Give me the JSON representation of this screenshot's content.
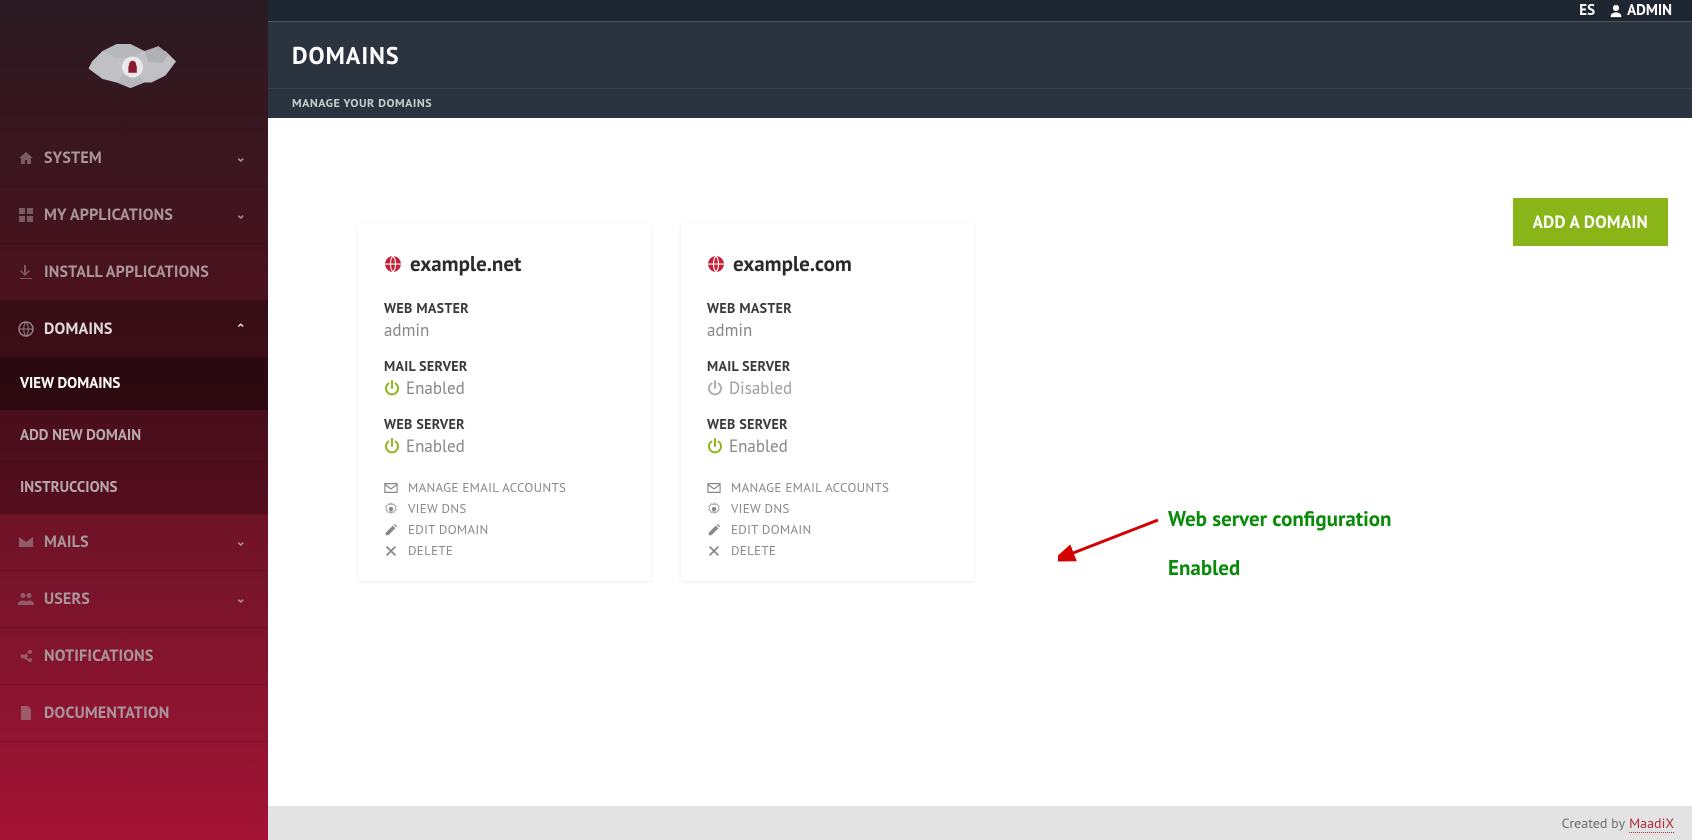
{
  "topbar": {
    "lang": "ES",
    "user": "ADMIN"
  },
  "sidebar": {
    "items": [
      {
        "label": "SYSTEM",
        "expandable": true
      },
      {
        "label": "MY APPLICATIONS",
        "expandable": true
      },
      {
        "label": "INSTALL APPLICATIONS",
        "expandable": false
      },
      {
        "label": "DOMAINS",
        "expandable": true,
        "open": true,
        "children": [
          {
            "label": "VIEW DOMAINS",
            "active": true
          },
          {
            "label": "ADD NEW DOMAIN"
          },
          {
            "label": "INSTRUCCIONS"
          }
        ]
      },
      {
        "label": "MAILS",
        "expandable": true
      },
      {
        "label": "USERS",
        "expandable": true
      },
      {
        "label": "NOTIFICATIONS",
        "expandable": false
      },
      {
        "label": "DOCUMENTATION",
        "expandable": false
      }
    ]
  },
  "header": {
    "title": "DOMAINS",
    "subtitle": "MANAGE YOUR DOMAINS"
  },
  "buttons": {
    "add_domain": "ADD A DOMAIN"
  },
  "labels": {
    "web_master": "WEB MASTER",
    "mail_server": "MAIL SERVER",
    "web_server": "WEB SERVER",
    "enabled": "Enabled",
    "disabled": "Disabled"
  },
  "actions": {
    "manage_email": "MANAGE EMAIL ACCOUNTS",
    "view_dns": "VIEW DNS",
    "edit_domain": "EDIT DOMAIN",
    "delete": "DELETE"
  },
  "domains": [
    {
      "name": "example.net",
      "web_master": "admin",
      "mail_server": "Enabled",
      "web_server": "Enabled"
    },
    {
      "name": "example.com",
      "web_master": "admin",
      "mail_server": "Disabled",
      "web_server": "Enabled"
    }
  ],
  "annotation": {
    "line1": "Web server configuration",
    "line2": "Enabled"
  },
  "footer": {
    "text": "Created by",
    "link": "MaadiX"
  }
}
